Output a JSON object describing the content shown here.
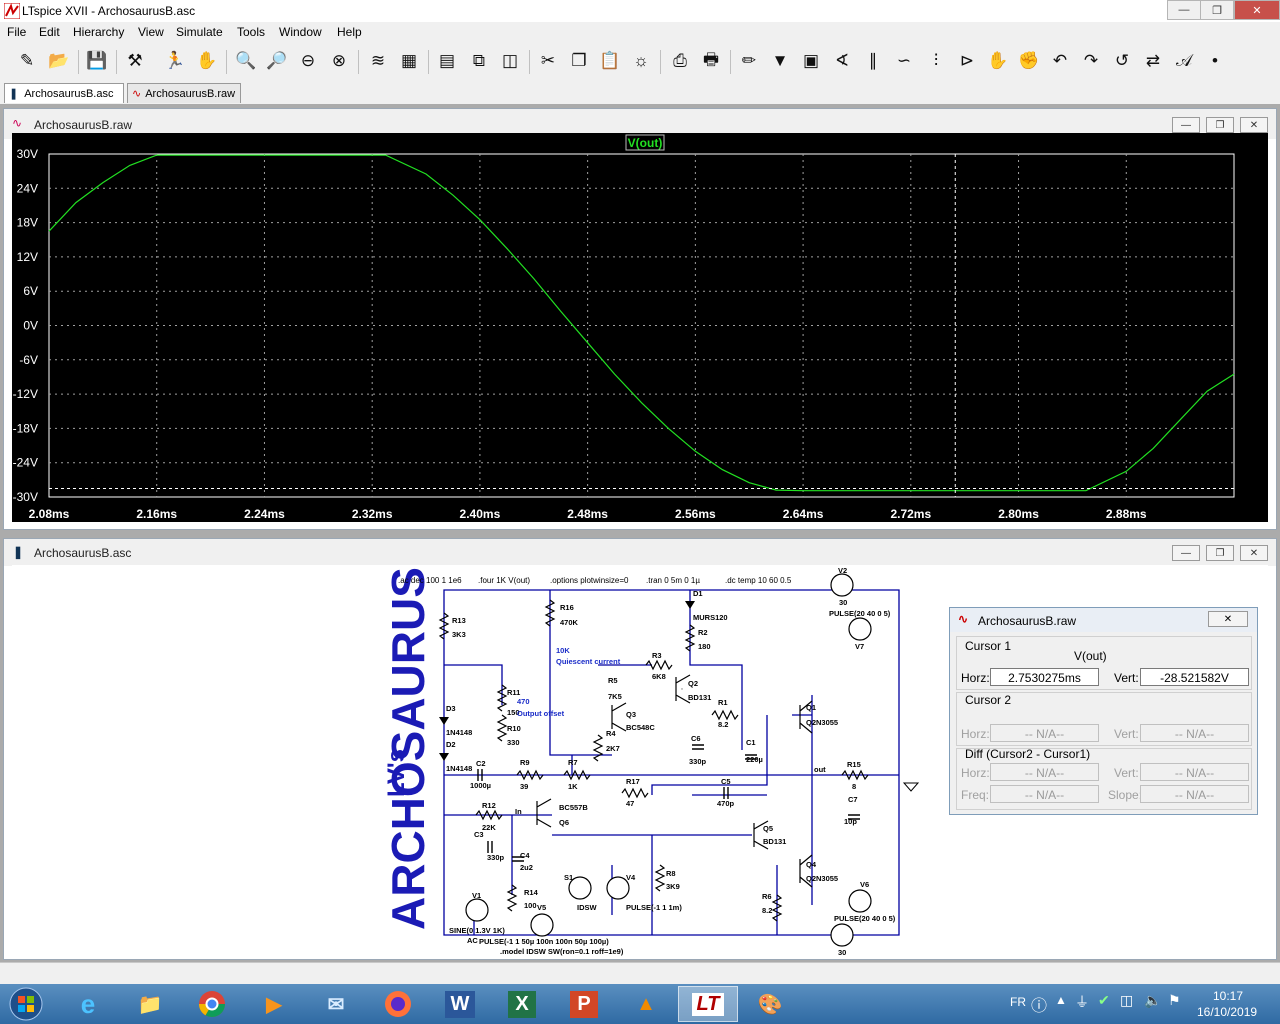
{
  "window": {
    "title": "LTspice XVII - ArchosaurusB.asc"
  },
  "menu": [
    "File",
    "Edit",
    "Hierarchy",
    "View",
    "Simulate",
    "Tools",
    "Window",
    "Help"
  ],
  "toolbar": {
    "icons": [
      "new-schematic-icon",
      "open-icon",
      "save-icon",
      "control-panel-icon",
      "run-icon",
      "halt-icon",
      "zoom-in-icon",
      "zoom-pan-icon",
      "zoom-out-icon",
      "zoom-fit-icon",
      "autorange-icon",
      "ruler-icon",
      "tile-horizontal-icon",
      "cascade-icon",
      "tile-vertical-icon",
      "cut-icon",
      "copy-icon",
      "paste-icon",
      "find-icon",
      "print-setup-icon",
      "print-icon",
      "draw-wire-icon",
      "ground-icon",
      "label-net-icon",
      "resistor-icon",
      "capacitor-icon",
      "inductor-icon",
      "diode-icon",
      "component-icon",
      "move-icon",
      "drag-icon",
      "undo-icon",
      "redo-icon",
      "rotate-icon",
      "mirror-icon",
      "text-icon",
      "spice-directive-icon"
    ]
  },
  "tabs": [
    {
      "label": "ArchosaurusB.asc",
      "active": true
    },
    {
      "label": "ArchosaurusB.raw",
      "active": false
    }
  ],
  "waveform": {
    "title": "ArchosaurusB.raw",
    "trace_label": "V(out)",
    "colors": {
      "trace": "#22e022",
      "grid": "#a0a0a0",
      "axis_text": "#ffffff"
    }
  },
  "chart_data": {
    "type": "line",
    "title": "V(out)",
    "xlabel": "",
    "ylabel": "",
    "xlim": [
      2.08,
      2.96
    ],
    "ylim": [
      -30,
      30
    ],
    "grid": true,
    "x_ticks": [
      "2.08ms",
      "2.16ms",
      "2.24ms",
      "2.32ms",
      "2.40ms",
      "2.48ms",
      "2.56ms",
      "2.64ms",
      "2.72ms",
      "2.80ms",
      "2.88ms"
    ],
    "y_ticks": [
      "30V",
      "24V",
      "18V",
      "12V",
      "6V",
      "0V",
      "-6V",
      "-12V",
      "-18V",
      "-24V",
      "-30V"
    ],
    "cursor_level": -28.52,
    "cursor_x": 2.753,
    "series": [
      {
        "name": "V(out)",
        "x": [
          2.08,
          2.1,
          2.12,
          2.14,
          2.16,
          2.18,
          2.2,
          2.22,
          2.24,
          2.26,
          2.28,
          2.3,
          2.32,
          2.33,
          2.36,
          2.38,
          2.4,
          2.42,
          2.44,
          2.46,
          2.48,
          2.5,
          2.52,
          2.54,
          2.56,
          2.58,
          2.6,
          2.62,
          2.64,
          2.66,
          2.68,
          2.7,
          2.72,
          2.74,
          2.76,
          2.78,
          2.8,
          2.82,
          2.84,
          2.85,
          2.88,
          2.9,
          2.92,
          2.94,
          2.96
        ],
        "y": [
          16.5,
          21.5,
          25.0,
          28.0,
          29.8,
          29.8,
          29.8,
          29.8,
          29.8,
          29.8,
          29.8,
          29.8,
          29.8,
          29.8,
          26.5,
          22.8,
          18.5,
          13.5,
          8.2,
          2.5,
          -3.0,
          -8.5,
          -13.5,
          -18.0,
          -22.0,
          -25.2,
          -27.5,
          -28.8,
          -28.9,
          -28.9,
          -28.9,
          -28.9,
          -28.9,
          -28.9,
          -28.9,
          -28.9,
          -28.9,
          -28.9,
          -28.9,
          -28.9,
          -25.5,
          -21.5,
          -16.5,
          -11.5,
          -8.5
        ]
      }
    ]
  },
  "schematic": {
    "title": "ArchosaurusB.asc",
    "logo_line1": "LV's",
    "logo_line2": "ARCHOSAURUS",
    "directives": [
      ".ac dec 100 1 1e6",
      ".four 1K V(out)",
      ".options plotwinsize=0",
      ".tran 0 5m 0 1µ",
      ".dc temp 10 60 0.5"
    ],
    "labels": [
      "R13",
      "3K3",
      "R16",
      "470K",
      "D1",
      "MURS120",
      "R2",
      "180",
      "V2",
      "30",
      "PULSE(20 40 0 5)",
      "V7",
      "10K",
      "Quiescent current",
      "R3",
      "6K8",
      "R5",
      "7K5",
      "Q2",
      "BD131",
      "R11",
      "150",
      "470",
      "Output offset",
      "R10",
      "330",
      "Q3",
      "BC548C",
      "R1",
      "8.2",
      "Q1",
      "Q2N3055",
      "D3",
      "1N4148",
      "D2",
      "1N4148",
      "R4",
      "2K7",
      "C6",
      "330p",
      "C1",
      "220µ",
      "C2",
      "1000µ",
      "R9",
      "39",
      "R7",
      "1K",
      "out",
      "R15",
      "8",
      "R17",
      "47",
      "C5",
      "470p",
      "R12",
      "22K",
      "In",
      "BC557B",
      "Q6",
      "C7",
      "10p",
      "C3",
      "330p",
      "Q5",
      "BD131",
      "C4",
      "2u2",
      "S1",
      "V4",
      "R8",
      "3K9",
      "Q4",
      "Q2N3055",
      "V1",
      "R14",
      "100",
      "V5",
      "IDSW",
      "PULSE(-1 1 1m)",
      "R6",
      "8.2",
      "V6",
      "PULSE(20 40 0 5)",
      "SINE(0 1.3V 1K)",
      "AC",
      "PULSE(-1 1 50µ 100n 100n 50µ 100µ)",
      ".model IDSW SW(ron=0.1 roff=1e9)",
      "30"
    ]
  },
  "cursor_dialog": {
    "title": "ArchosaurusB.raw",
    "cursor1": {
      "label": "Cursor 1",
      "trace": "V(out)",
      "horz_label": "Horz:",
      "horz": "2.7530275ms",
      "vert_label": "Vert:",
      "vert": "-28.521582V"
    },
    "cursor2": {
      "label": "Cursor 2",
      "horz_label": "Horz:",
      "horz": "-- N/A--",
      "vert_label": "Vert:",
      "vert": "-- N/A--"
    },
    "diff": {
      "label": "Diff (Cursor2 - Cursor1)",
      "horz_label": "Horz:",
      "horz": "-- N/A--",
      "vert_label": "Vert:",
      "vert": "-- N/A--",
      "freq_label": "Freq:",
      "freq": "-- N/A--",
      "slope_label": "Slope:",
      "slope": "-- N/A--"
    }
  },
  "taskbar": {
    "apps": [
      "start-icon",
      "ie-icon",
      "explorer-icon",
      "chrome-icon",
      "media-player-icon",
      "thunderbird-icon",
      "firefox-icon",
      "word-icon",
      "excel-icon",
      "powerpoint-icon",
      "vlc-icon",
      "ltspice-icon",
      "paint-icon"
    ],
    "lang": "FR",
    "time": "10:17",
    "date": "16/10/2019"
  }
}
